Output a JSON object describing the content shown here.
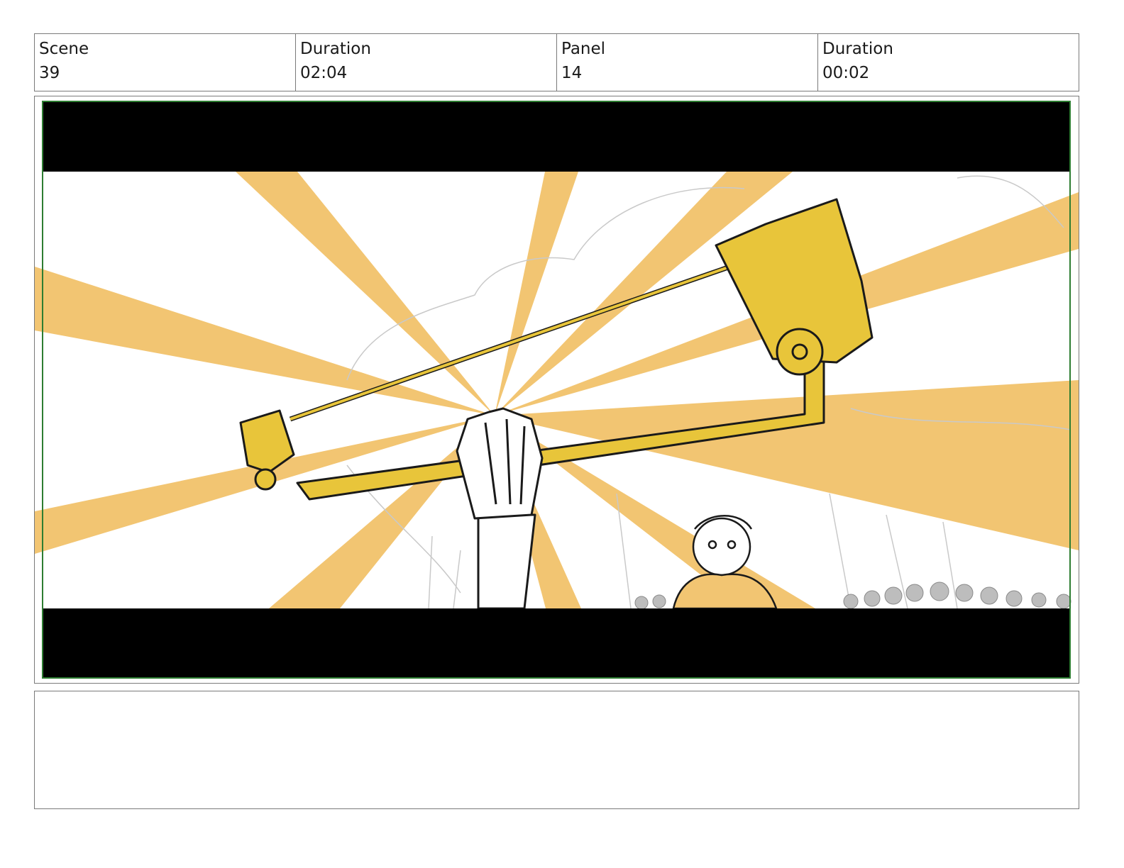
{
  "header": {
    "scene_label": "Scene",
    "scene_value": "39",
    "scene_duration_label": "Duration",
    "scene_duration_value": "02:04",
    "panel_label": "Panel",
    "panel_value": "14",
    "panel_duration_label": "Duration",
    "panel_duration_value": "00:02"
  },
  "frame": {
    "letterbox_color": "#000000",
    "ray_color": "#f2c572",
    "weapon_color": "#e8c53a",
    "safe_frame_color": "#2e7d32"
  },
  "notes": {
    "text": ""
  }
}
